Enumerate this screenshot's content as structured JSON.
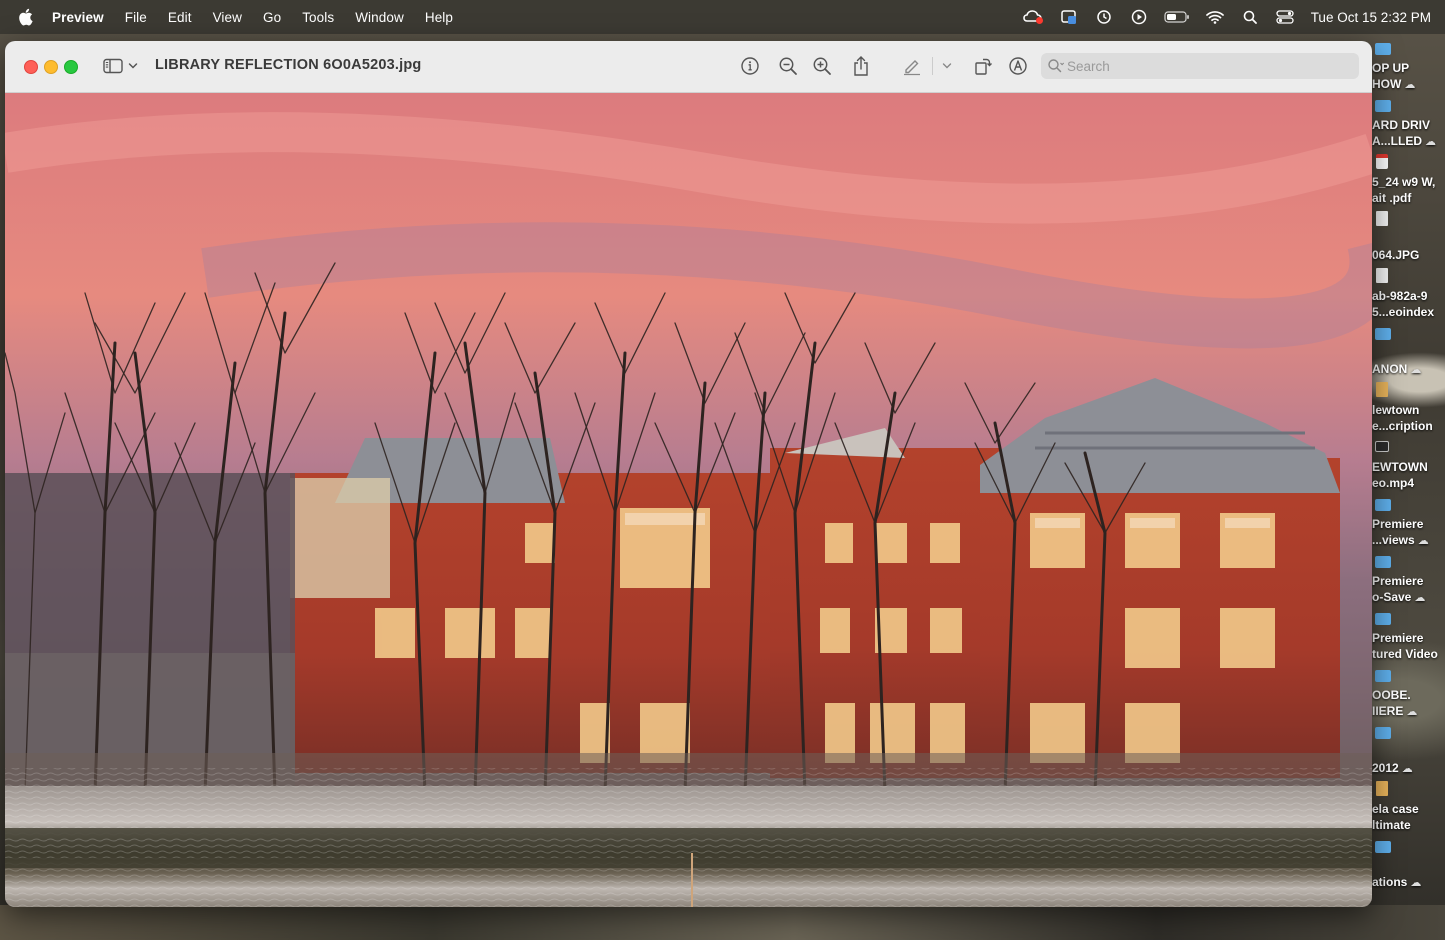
{
  "menubar": {
    "apple_icon": "apple-logo-icon",
    "app_name": "Preview",
    "menus": [
      "File",
      "Edit",
      "View",
      "Go",
      "Tools",
      "Window",
      "Help"
    ],
    "status_icons": [
      "creative-cloud-icon",
      "finder-sync-icon",
      "time-machine-icon",
      "play-icon",
      "battery-icon",
      "wifi-icon",
      "spotlight-search-icon",
      "control-center-icon"
    ],
    "clock": "Tue Oct 15  2:32 PM"
  },
  "window": {
    "title": "LIBRARY REFLECTION 6O0A5203.jpg",
    "toolbar_icons": [
      "sidebar-toggle-icon",
      "chevron-down-icon",
      "info-icon",
      "zoom-out-icon",
      "zoom-in-icon",
      "share-icon",
      "markup-pen-icon",
      "chevron-down-icon",
      "rotate-icon",
      "markup-toolbar-icon"
    ],
    "search": {
      "placeholder": "Search",
      "value": ""
    }
  },
  "colors": {
    "sky": "#e28781",
    "brick": "#b0412d",
    "roof": "#8d8f96",
    "tree": "#2d2320",
    "window_light": "#f2c98a",
    "folder_blue": "#5fb0ec"
  },
  "desktop_icons": [
    {
      "type": "folder",
      "line1": "OP UP",
      "line2": "HOW",
      "cloud": true
    },
    {
      "type": "folder",
      "line1": "ARD DRIV",
      "line2": "A...LLED",
      "cloud": true
    },
    {
      "type": "pdf",
      "line1": "5_24 w9 W,",
      "line2": "ait .pdf",
      "cloud": false
    },
    {
      "type": "doc",
      "line1": "",
      "line2": "064.JPG",
      "cloud": false
    },
    {
      "type": "doc",
      "line1": "ab-982a-9",
      "line2": "5...eoindex",
      "cloud": false
    },
    {
      "type": "folder",
      "line1": "",
      "line2": "ANON",
      "cloud": true
    },
    {
      "type": "img",
      "line1": "lewtown",
      "line2": "e...cription",
      "cloud": false
    },
    {
      "type": "vid",
      "line1": "EWTOWN",
      "line2": "eo.mp4",
      "cloud": false
    },
    {
      "type": "folder",
      "line1": "Premiere",
      "line2": "...views",
      "cloud": true
    },
    {
      "type": "folder",
      "line1": "Premiere",
      "line2": "o-Save",
      "cloud": true
    },
    {
      "type": "folder",
      "line1": "Premiere",
      "line2": "tured Video",
      "cloud": false
    },
    {
      "type": "folder",
      "line1": "OOBE.",
      "line2": "IIERE",
      "cloud": true
    },
    {
      "type": "folder",
      "line1": "",
      "line2": "2012",
      "cloud": true
    },
    {
      "type": "img",
      "line1": "ela case",
      "line2": "ltimate",
      "cloud": false
    },
    {
      "type": "folder",
      "line1": "",
      "line2": "ations",
      "cloud": true
    }
  ]
}
